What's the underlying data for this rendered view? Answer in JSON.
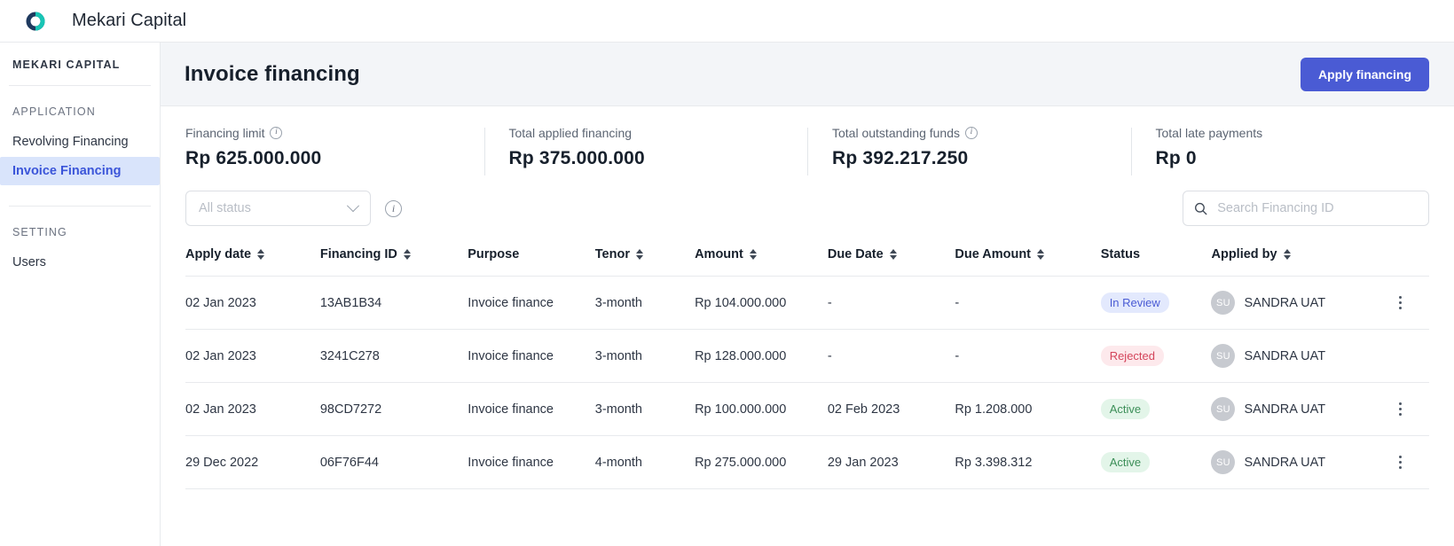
{
  "topbar": {
    "logo_icon": "mekari-ring-logo-icon",
    "brand": "Mekari Capital"
  },
  "sidebar": {
    "org": "MEKARI CAPITAL",
    "groups": [
      {
        "label": "APPLICATION",
        "items": [
          {
            "label": "Revolving Financing",
            "active": false
          },
          {
            "label": "Invoice Financing",
            "active": true
          }
        ]
      },
      {
        "label": "SETTING",
        "items": [
          {
            "label": "Users",
            "active": false
          }
        ]
      }
    ]
  },
  "header": {
    "title": "Invoice financing",
    "apply_button": "Apply financing"
  },
  "stats": [
    {
      "label": "Financing limit",
      "info": true,
      "value": "Rp 625.000.000"
    },
    {
      "label": "Total applied financing",
      "info": false,
      "value": "Rp 375.000.000"
    },
    {
      "label": "Total outstanding funds",
      "info": true,
      "value": "Rp 392.217.250"
    },
    {
      "label": "Total late payments",
      "info": false,
      "value": "Rp 0"
    }
  ],
  "filters": {
    "status_select": "All status",
    "status_options": [
      "All status"
    ],
    "chevron_icon": "chevron-down-icon",
    "info_icon": "info-circle-icon",
    "search_icon": "search-icon",
    "search_placeholder": "Search Financing ID",
    "search_value": ""
  },
  "table": {
    "columns": [
      {
        "label": "Apply date",
        "sortable": true
      },
      {
        "label": "Financing ID",
        "sortable": true
      },
      {
        "label": "Purpose",
        "sortable": false
      },
      {
        "label": "Tenor",
        "sortable": true
      },
      {
        "label": "Amount",
        "sortable": true
      },
      {
        "label": "Due Date",
        "sortable": true
      },
      {
        "label": "Due Amount",
        "sortable": true
      },
      {
        "label": "Status",
        "sortable": false
      },
      {
        "label": "Applied by",
        "sortable": true
      }
    ],
    "rows": [
      {
        "apply_date": "02 Jan 2023",
        "financing_id": "13AB1B34",
        "purpose": "Invoice finance",
        "tenor": "3-month",
        "amount": "Rp 104.000.000",
        "due_date": "-",
        "due_amount": "-",
        "status": "In Review",
        "status_kind": "review",
        "avatar_initials": "SU",
        "applied_by": "SANDRA UAT",
        "has_actions": true
      },
      {
        "apply_date": "02 Jan 2023",
        "financing_id": "3241C278",
        "purpose": "Invoice finance",
        "tenor": "3-month",
        "amount": "Rp 128.000.000",
        "due_date": "-",
        "due_amount": "-",
        "status": "Rejected",
        "status_kind": "rejected",
        "avatar_initials": "SU",
        "applied_by": "SANDRA UAT",
        "has_actions": false
      },
      {
        "apply_date": "02 Jan 2023",
        "financing_id": "98CD7272",
        "purpose": "Invoice finance",
        "tenor": "3-month",
        "amount": "Rp 100.000.000",
        "due_date": "02 Feb 2023",
        "due_amount": "Rp 1.208.000",
        "status": "Active",
        "status_kind": "active",
        "avatar_initials": "SU",
        "applied_by": "SANDRA UAT",
        "has_actions": true
      },
      {
        "apply_date": "29 Dec 2022",
        "financing_id": "06F76F44",
        "purpose": "Invoice finance",
        "tenor": "4-month",
        "amount": "Rp 275.000.000",
        "due_date": "29 Jan 2023",
        "due_amount": "Rp 3.398.312",
        "status": "Active",
        "status_kind": "active",
        "avatar_initials": "SU",
        "applied_by": "SANDRA UAT",
        "has_actions": true
      }
    ]
  },
  "colors": {
    "primary": "#4a5bd4",
    "sidebar_active_bg": "#d9e4fb",
    "sidebar_active_text": "#3b55d9",
    "header_bg": "#f3f5f8",
    "status_review": "#4a5bd4",
    "status_rejected": "#d4455b",
    "status_active": "#3c8f58",
    "logo_dark": "#1f3a5f",
    "logo_teal": "#18c5b5"
  }
}
